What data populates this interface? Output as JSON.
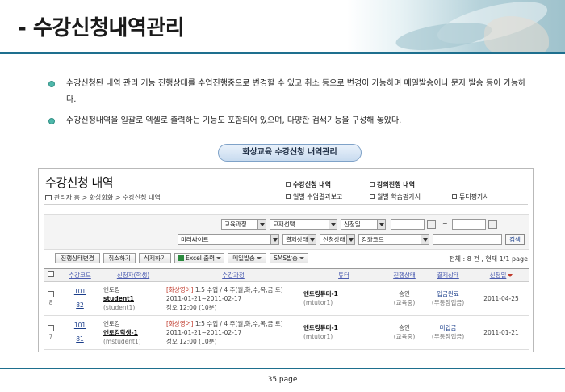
{
  "slide": {
    "title": "- 수강신청내역관리",
    "bullets": [
      "수강신청된 내역 관리 기능 진행상태를 수업진행중으로 변경할 수 있고 취소 등으로 변경이 가능하며 메일발송이나 문자 발송 등이 가능하다.",
      "수강신청내역을 일괄로 엑셀로 출력하는 기능도 포함되어 있으며, 다양한 검색기능을 구성해 놓았다."
    ],
    "caption": "화상교육 수강신청 내역관리",
    "footer": "35 page"
  },
  "panel": {
    "title": "수강신청 내역",
    "breadcrumb": "관리자 홈 > 화상회화 > 수강신청 내역",
    "menu": [
      {
        "label": "수강신청 내역",
        "bold": true
      },
      {
        "label": "강의진행 내역",
        "bold": true
      },
      {
        "label": "일별 수업결과보고",
        "bold": false
      },
      {
        "label": "월별 학습평가서",
        "bold": false
      },
      {
        "label": "튜터평가서",
        "bold": false
      }
    ],
    "search": {
      "course_select": "교육과정",
      "material_select": "교재선택",
      "date_type_select": "신청일",
      "date_sep": "~",
      "site_select": "미러싸이트",
      "payment_select": "결제상태",
      "apply_status_select": "신청상태",
      "code_select": "강좌코드",
      "search_button": "검색"
    },
    "toolbar": {
      "status_change": "진행상태변경",
      "cancel": "취소하기",
      "delete": "삭제하기",
      "excel": "Excel 출력",
      "mail": "메일발송",
      "sms": "SMS발송"
    },
    "total_text": "전체 : 8 건 , 현재 1/1 page",
    "table": {
      "headers": [
        "수강코드",
        "신청자(학생)",
        "수강과정",
        "튜터",
        "진행상태",
        "결제상태",
        "신청일"
      ],
      "rows": [
        {
          "no": "8",
          "code1": "101",
          "code2": "82",
          "applicant_top": "엔토킹",
          "applicant_name": "student1",
          "applicant_id": "(student1)",
          "course_tag": "[화상영어]",
          "course_desc": "1:5 수업 / 4 주(월,화,수,목,금,토)",
          "course_period": "2011-01-21~2011-02-17",
          "course_time": "정오 12:00 (10분)",
          "tutor_name": "엔토킹튜터-1",
          "tutor_id": "(mtutor1)",
          "progress": "승인",
          "progress_sub": "(교육중)",
          "payment": "입금완료",
          "payment_sub": "(무통장입금)",
          "date": "2011-04-25"
        },
        {
          "no": "7",
          "code1": "101",
          "code2": "81",
          "applicant_top": "엔토킹",
          "applicant_name": "엔토킹학생-1",
          "applicant_id": "(mstudent1)",
          "course_tag": "[화상영어]",
          "course_desc": "1:5 수업 / 4 주(월,화,수,목,금,토)",
          "course_period": "2011-01-21~2011-02-17",
          "course_time": "정오 12:00 (10분)",
          "tutor_name": "엔토킹튜터-1",
          "tutor_id": "(mtutor1)",
          "progress": "승인",
          "progress_sub": "(교육중)",
          "payment": "미입금",
          "payment_sub": "(무통장입금)",
          "date": "2011-01-21"
        }
      ]
    }
  }
}
